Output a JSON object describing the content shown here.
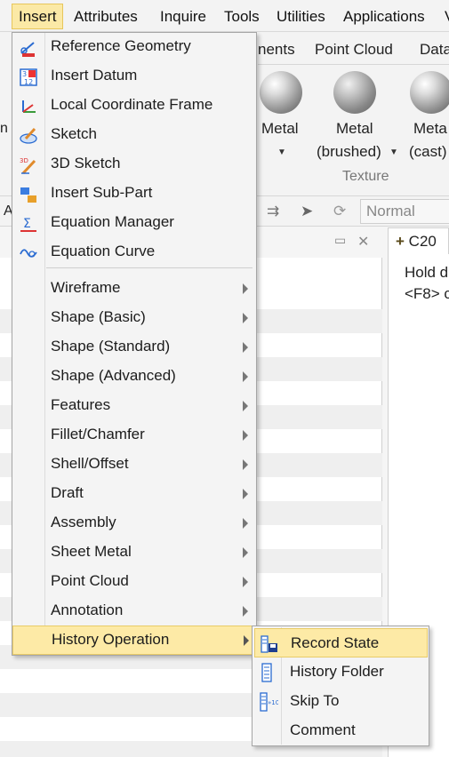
{
  "menubar": {
    "items": [
      "Insert",
      "Attributes",
      "Inquire",
      "Tools",
      "Utilities",
      "Applications",
      "V"
    ]
  },
  "ribbon": {
    "tab_fragment": "nents",
    "tab_point_cloud": "Point Cloud",
    "tab_data_fragment": "Data",
    "materials": [
      {
        "line1": "Metal",
        "line2": ""
      },
      {
        "line1": "Metal",
        "line2": "(brushed)"
      },
      {
        "line1": "Meta",
        "line2": "(cast)"
      }
    ],
    "group_label": "Texture",
    "left_fragment_1": "n",
    "left_fragment_2": "A",
    "display_mode": "Normal"
  },
  "right_panel": {
    "tab_label": "C20",
    "line1": "Hold d",
    "line2": "<F8> c"
  },
  "insert_menu": {
    "items": [
      {
        "label": "Reference Geometry",
        "icon": "reference-geometry-icon",
        "submenu": false
      },
      {
        "label": "Insert Datum",
        "icon": "datum-icon",
        "submenu": false
      },
      {
        "label": "Local Coordinate Frame",
        "icon": "coordinate-frame-icon",
        "submenu": false
      },
      {
        "label": "Sketch",
        "icon": "sketch-icon",
        "submenu": false
      },
      {
        "label": "3D Sketch",
        "icon": "3d-sketch-icon",
        "submenu": false
      },
      {
        "label": "Insert Sub-Part",
        "icon": "sub-part-icon",
        "submenu": false
      },
      {
        "label": "Equation Manager",
        "icon": "equation-manager-icon",
        "submenu": false
      },
      {
        "label": "Equation Curve",
        "icon": "equation-curve-icon",
        "submenu": false
      },
      {
        "label": "Wireframe",
        "submenu": true
      },
      {
        "label": "Shape (Basic)",
        "submenu": true
      },
      {
        "label": "Shape (Standard)",
        "submenu": true
      },
      {
        "label": "Shape (Advanced)",
        "submenu": true
      },
      {
        "label": "Features",
        "submenu": true
      },
      {
        "label": "Fillet/Chamfer",
        "submenu": true
      },
      {
        "label": "Shell/Offset",
        "submenu": true
      },
      {
        "label": "Draft",
        "submenu": true
      },
      {
        "label": "Assembly",
        "submenu": true
      },
      {
        "label": "Sheet Metal",
        "submenu": true
      },
      {
        "label": "Point Cloud",
        "submenu": true
      },
      {
        "label": "Annotation",
        "submenu": true
      },
      {
        "label": "History Operation",
        "submenu": true,
        "highlighted": true
      }
    ]
  },
  "history_submenu": {
    "items": [
      {
        "label": "Record State",
        "icon": "record-state-icon",
        "highlighted": true
      },
      {
        "label": "History Folder",
        "icon": "history-folder-icon"
      },
      {
        "label": "Skip To",
        "icon": "skip-to-icon"
      },
      {
        "label": "Comment",
        "icon": ""
      }
    ]
  },
  "colors": {
    "highlight": "#fdeaa6",
    "highlight_border": "#e8cb68",
    "menu_bg": "#f4f4f4"
  }
}
